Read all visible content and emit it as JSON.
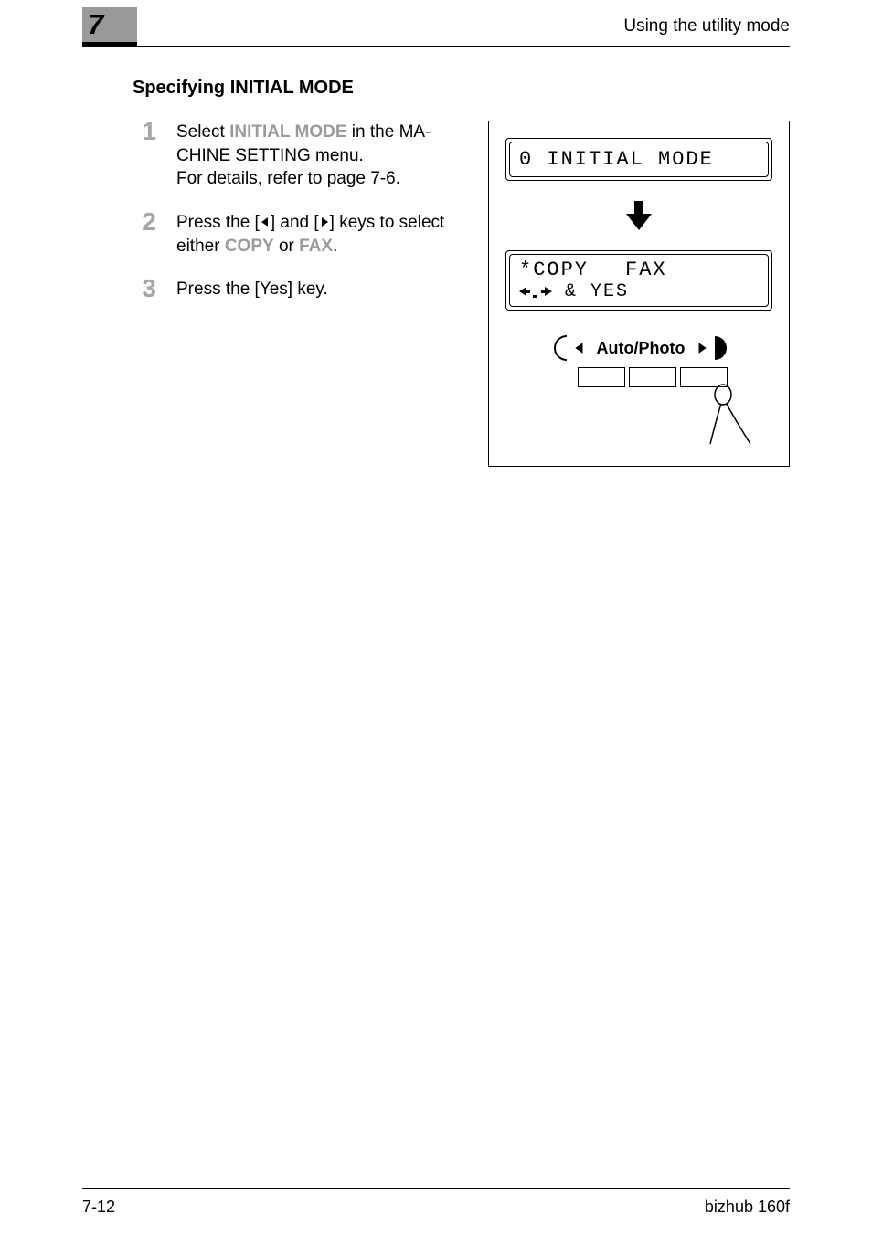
{
  "chapter": "7",
  "header_title": "Using the utility mode",
  "section_title": "Specifying INITIAL MODE",
  "steps": {
    "s1": {
      "num": "1",
      "pre": "Select ",
      "kw": "INITIAL MODE",
      "post": " in the MA­CHINE SETTING menu.",
      "line2": "For details, refer to page 7-6."
    },
    "s2": {
      "num": "2",
      "pre": "Press the [",
      "mid": "] and [",
      "post2": "] keys to select either ",
      "kw1": "COPY",
      "or": " or ",
      "kw2": "FAX",
      "end": "."
    },
    "s3": {
      "num": "3",
      "text": "Press the [Yes] key."
    }
  },
  "screen": {
    "lcd1": "0 INITIAL MODE",
    "lcd2_line1_a": "*COPY",
    "lcd2_line1_b": "FAX",
    "lcd2_line2_tail": " & YES",
    "auto_photo": "Auto/Photo"
  },
  "footer": {
    "left": "7-12",
    "right": "bizhub 160f"
  }
}
